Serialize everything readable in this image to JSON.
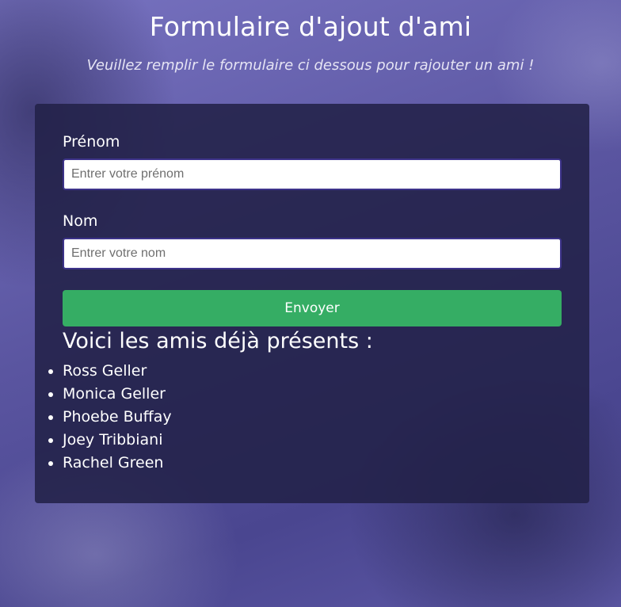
{
  "header": {
    "title": "Formulaire d'ajout d'ami",
    "subtitle": "Veuillez remplir le formulaire ci dessous pour rajouter un ami !"
  },
  "form": {
    "first_name_label": "Prénom",
    "first_name_placeholder": "Entrer votre prénom",
    "first_name_value": "",
    "last_name_label": "Nom",
    "last_name_placeholder": "Entrer votre nom",
    "last_name_value": "",
    "submit_label": "Envoyer"
  },
  "friends": {
    "heading": "Voici les amis déjà présents :",
    "items": [
      "Ross Geller",
      "Monica Geller",
      "Phoebe Buffay",
      "Joey Tribbiani",
      "Rachel Green"
    ]
  },
  "colors": {
    "card_background": "#222148",
    "submit_button": "#35ad64",
    "input_border": "#3d338a",
    "page_background": "#5f5aa6"
  }
}
